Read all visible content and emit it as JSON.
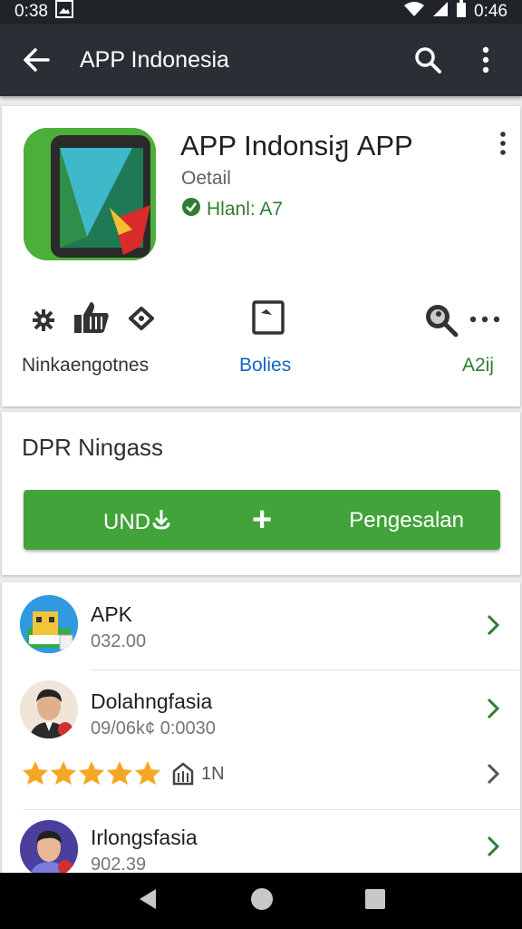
{
  "status": {
    "time": "0:38",
    "right_text": "0:46"
  },
  "app_bar": {
    "title": "APP Indonesia"
  },
  "app": {
    "name": "APP Indonsiჟ APP",
    "developer": "Oetail",
    "badge": "Hlanl: A7"
  },
  "stats": {
    "left_label": "Ninkaengotnes",
    "center_label": "Bolies",
    "right_label": "A2ĳ"
  },
  "install": {
    "section_title": "DPR Ningass",
    "left_label": "UND",
    "right_label": "Pengesalan"
  },
  "list": [
    {
      "title": "APK",
      "sub": "032.00"
    },
    {
      "title": "Dolahngfasia",
      "sub": "09/06k¢ 0:0030"
    },
    {
      "rating_stars": 5,
      "rating_label": "1N"
    },
    {
      "title": "Irlongsfasia",
      "sub": "902.39"
    }
  ],
  "colors": {
    "accent_green": "#41a33a",
    "link_blue": "#1565c0",
    "badge_green": "#2e7d32",
    "star": "#f5a623"
  }
}
